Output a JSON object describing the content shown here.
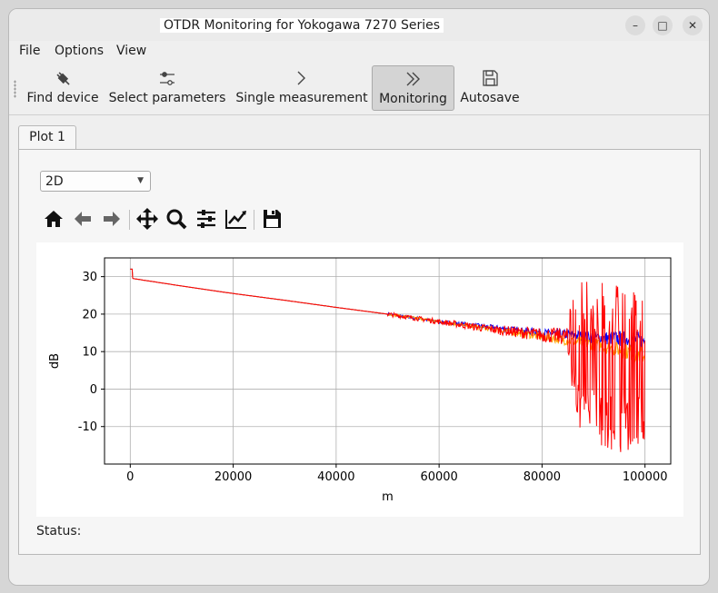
{
  "window": {
    "title": "OTDR Monitoring for Yokogawa 7270 Series",
    "controls": {
      "minimize": "–",
      "maximize": "□",
      "close": "✕"
    }
  },
  "menubar": {
    "items": [
      "File",
      "Options",
      "View"
    ]
  },
  "toolbar": {
    "buttons": [
      {
        "label": "Find device",
        "icon": "plug-icon"
      },
      {
        "label": "Select parameters",
        "icon": "sliders-icon"
      },
      {
        "label": "Single measurement",
        "icon": "chevron-right-icon"
      },
      {
        "label": "Monitoring",
        "icon": "double-chevron-right-icon",
        "active": true
      },
      {
        "label": "Autosave",
        "icon": "floppy-disk-icon"
      }
    ]
  },
  "tabs": [
    {
      "label": "Plot 1",
      "selected": true
    }
  ],
  "plot": {
    "mode_select": {
      "value": "2D"
    },
    "nav_toolbar": [
      "home-icon",
      "back-icon",
      "forward-icon",
      "pan-icon",
      "zoom-icon",
      "configure-subplots-icon",
      "edit-axis-icon",
      "save-figure-icon"
    ]
  },
  "status": {
    "label": "Status:"
  },
  "chart_data": {
    "type": "line",
    "title": "",
    "xlabel": "m",
    "ylabel": "dB",
    "xlim": [
      -5000,
      105000
    ],
    "ylim": [
      -20,
      35
    ],
    "xticks": [
      "0",
      "20000",
      "40000",
      "60000",
      "80000",
      "100000"
    ],
    "yticks": [
      "30",
      "20",
      "10",
      "0",
      "-10"
    ],
    "grid": true,
    "series": [
      {
        "color": "#0000ff",
        "x": [
          0,
          500,
          10000,
          20000,
          30000,
          40000,
          50000,
          60000,
          70000,
          80000,
          85000,
          90000,
          95000,
          100000
        ],
        "y": [
          32,
          29.5,
          27.5,
          25.5,
          23.7,
          21.8,
          20,
          18,
          16.5,
          15,
          14.5,
          13.8,
          13.5,
          13
        ]
      },
      {
        "color": "#ffa500",
        "x": [
          0,
          500,
          10000,
          20000,
          30000,
          40000,
          50000,
          60000,
          70000,
          80000,
          85000,
          90000,
          95000,
          100000
        ],
        "y": [
          32,
          29.5,
          27.5,
          25.5,
          23.7,
          21.8,
          20,
          18,
          16,
          14,
          13,
          12,
          10.5,
          9
        ]
      },
      {
        "color": "#ff0000",
        "x": [
          0,
          500,
          10000,
          20000,
          30000,
          40000,
          50000,
          60000,
          70000,
          80000,
          85000,
          90000,
          95000,
          100000
        ],
        "y": [
          32,
          29.5,
          27.5,
          25.5,
          23.7,
          21.8,
          20,
          18,
          16,
          14.5,
          14,
          14,
          14,
          14
        ],
        "noise_envelope": {
          "x": [
            60000,
            70000,
            80000,
            85000,
            87000,
            90000,
            95000,
            100000
          ],
          "min": [
            17,
            15,
            12,
            9,
            -14,
            -15,
            -17,
            -16
          ],
          "max": [
            19,
            17,
            17,
            20,
            30,
            28,
            29,
            28
          ]
        }
      }
    ]
  }
}
